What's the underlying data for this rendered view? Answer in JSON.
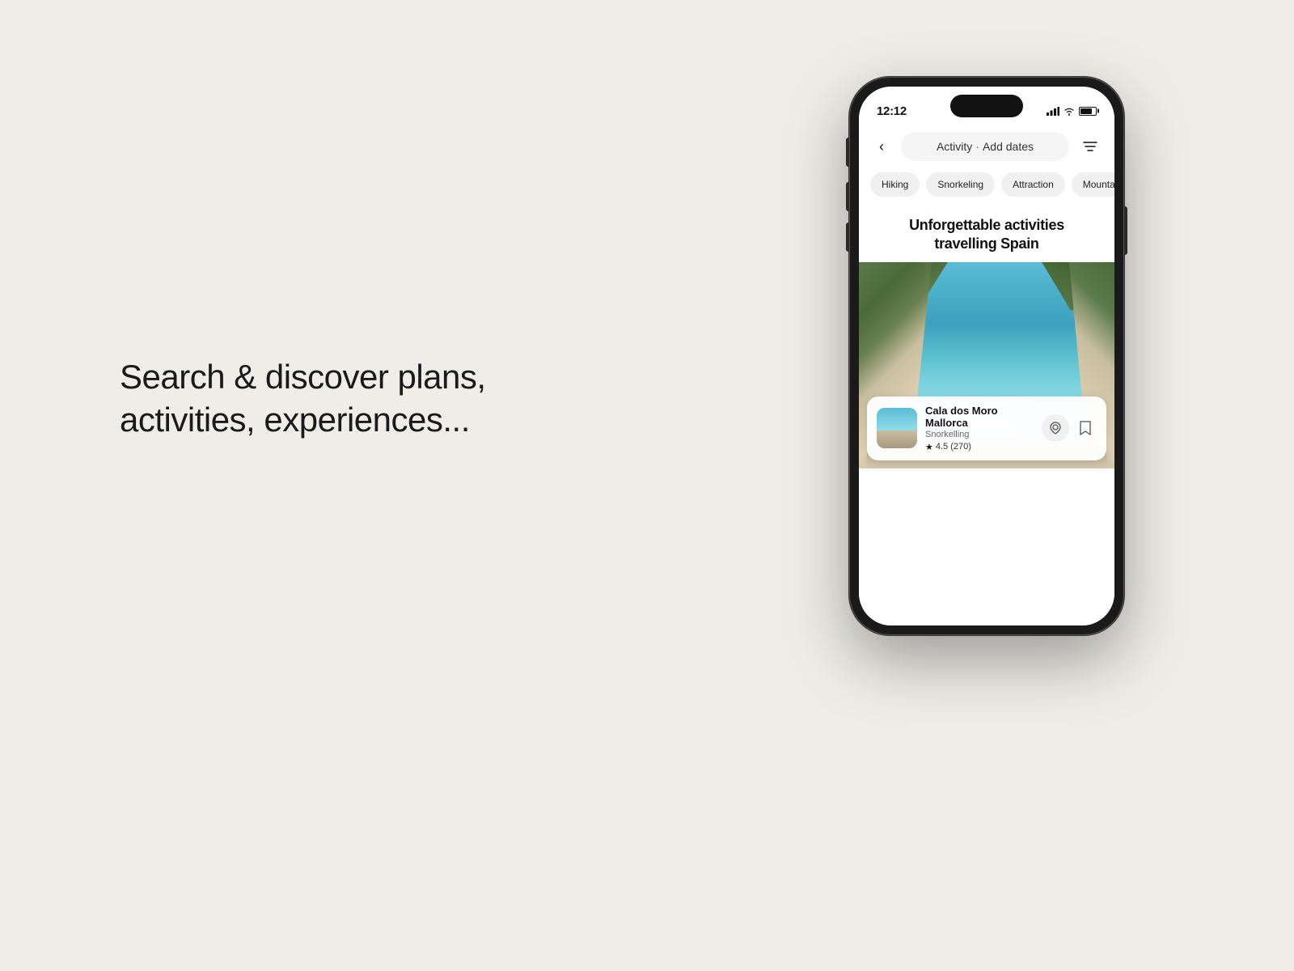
{
  "background": {
    "color": "#f0ede8"
  },
  "left_text": {
    "line1": "Search & discover plans,",
    "line2": "activities, experiences..."
  },
  "phone": {
    "status_bar": {
      "time": "12:12",
      "signal": "●●●",
      "wifi": "▲",
      "battery": "75"
    },
    "search_bar": {
      "back_label": "‹",
      "activity_label": "Activity",
      "separator": "·",
      "dates_label": "Add dates",
      "filter_icon": "≡"
    },
    "categories": [
      {
        "label": "Hiking"
      },
      {
        "label": "Snorkeling"
      },
      {
        "label": "Attraction"
      },
      {
        "label": "Mountain Bi..."
      }
    ],
    "hero": {
      "title_line1": "Unforgettable activities",
      "title_line2": "travelling Spain"
    },
    "activity_card": {
      "name": "Cala dos Moro Mallorca",
      "type": "Snorkelling",
      "rating": "4.5",
      "review_count": "(270)",
      "bookmark_icon": "🔖"
    }
  }
}
